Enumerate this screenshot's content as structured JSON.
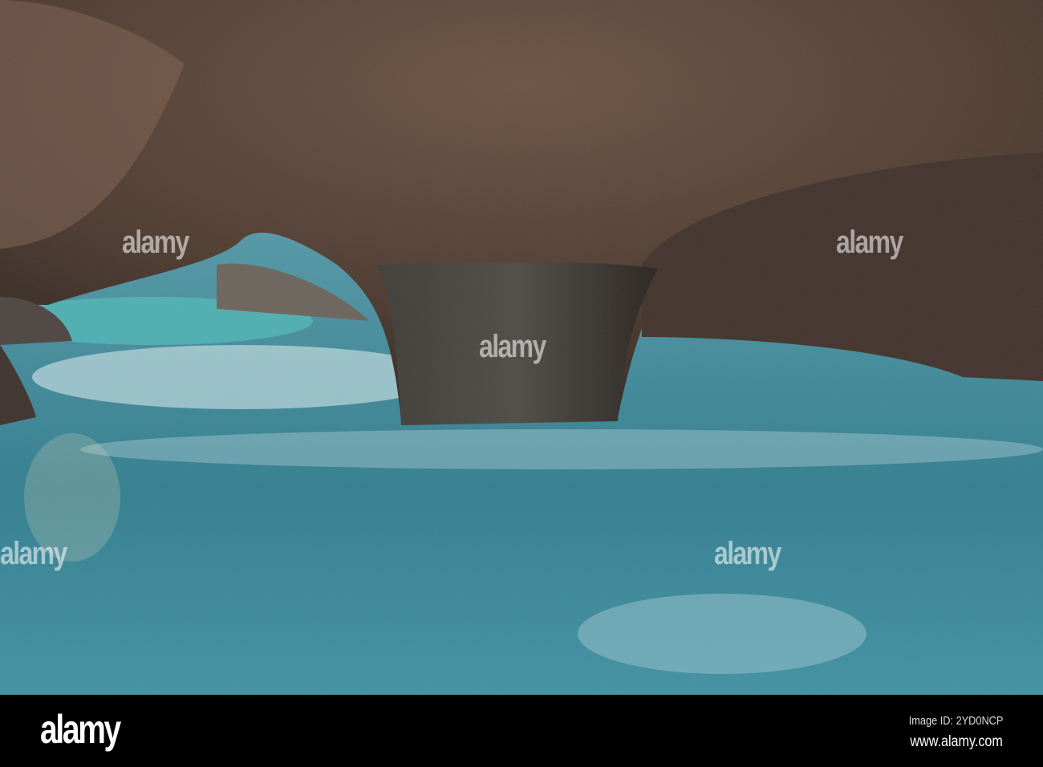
{
  "watermark": {
    "text": "alamy"
  },
  "footer": {
    "logo": "alamy",
    "image_id": "Image ID: 2YD0NCP",
    "website": "www.alamy.com"
  },
  "colors": {
    "rock": "#5a4436",
    "water": "#3f8fa0",
    "foam": "#cfe6ec",
    "footer": "#000000"
  }
}
